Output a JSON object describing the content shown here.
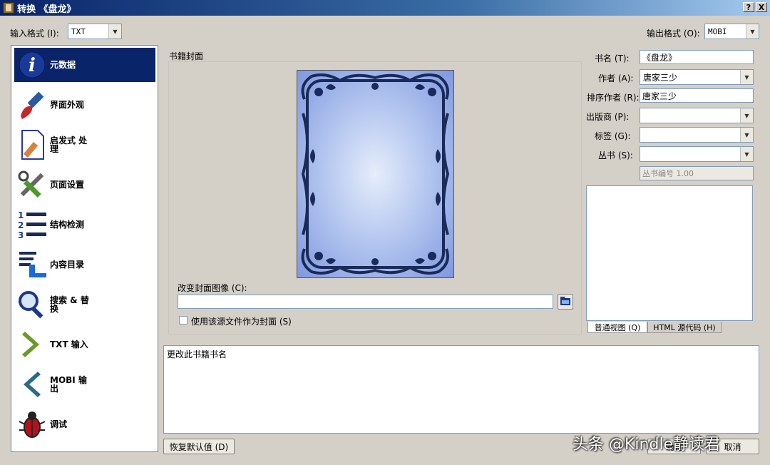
{
  "window": {
    "title": "转换 《盘龙》",
    "help_btn": "?",
    "close_btn": "X"
  },
  "formats": {
    "input_label": "输入格式 (I):",
    "input_value": "TXT",
    "output_label": "输出格式 (O):",
    "output_value": "MOBI"
  },
  "sidebar": {
    "items": [
      {
        "label": "元数据",
        "icon": "info-icon"
      },
      {
        "label": "界面外观",
        "icon": "paintbrush-icon"
      },
      {
        "label": "启发式 处理",
        "icon": "document-icon"
      },
      {
        "label": "页面设置",
        "icon": "tools-icon"
      },
      {
        "label": "结构检测",
        "icon": "list-numbered-icon"
      },
      {
        "label": "内容目录",
        "icon": "toc-icon"
      },
      {
        "label": "搜索 & 替换",
        "icon": "magnifier-icon"
      },
      {
        "label": "TXT 输入",
        "icon": "arrow-right-icon"
      },
      {
        "label": "MOBI 输出",
        "icon": "arrow-left-icon"
      },
      {
        "label": "调试",
        "icon": "bug-icon"
      }
    ]
  },
  "cover": {
    "group_label": "书籍封面",
    "change_label": "改变封面图像 (C):",
    "path_value": "",
    "use_source_label": "使用该源文件作为封面 (S)"
  },
  "metadata": {
    "title_label": "书名 (T):",
    "title_value": "《盘龙》",
    "author_label": "作者 (A):",
    "author_value": "唐家三少",
    "author_sort_label": "排序作者 (R):",
    "author_sort_value": "唐家三少",
    "publisher_label": "出版商 (P):",
    "publisher_value": "",
    "tags_label": "标签 (G):",
    "tags_value": "",
    "series_label": "丛书 (S):",
    "series_value": "",
    "series_index": "丛书编号 1.00"
  },
  "comments_tabs": {
    "normal": "普通视图 (Q)",
    "html": "HTML 源代码 (H)"
  },
  "description": "更改此书籍书名",
  "footer": {
    "restore_label": "恢复默认值 (D)",
    "ok_label": "确定",
    "cancel_label": "取消"
  },
  "watermark": "头条 @Kindle静读君",
  "colors": {
    "selected": "#0a246a",
    "titlebar": "#0a246a",
    "cover_frame": "#1a2a5a"
  }
}
